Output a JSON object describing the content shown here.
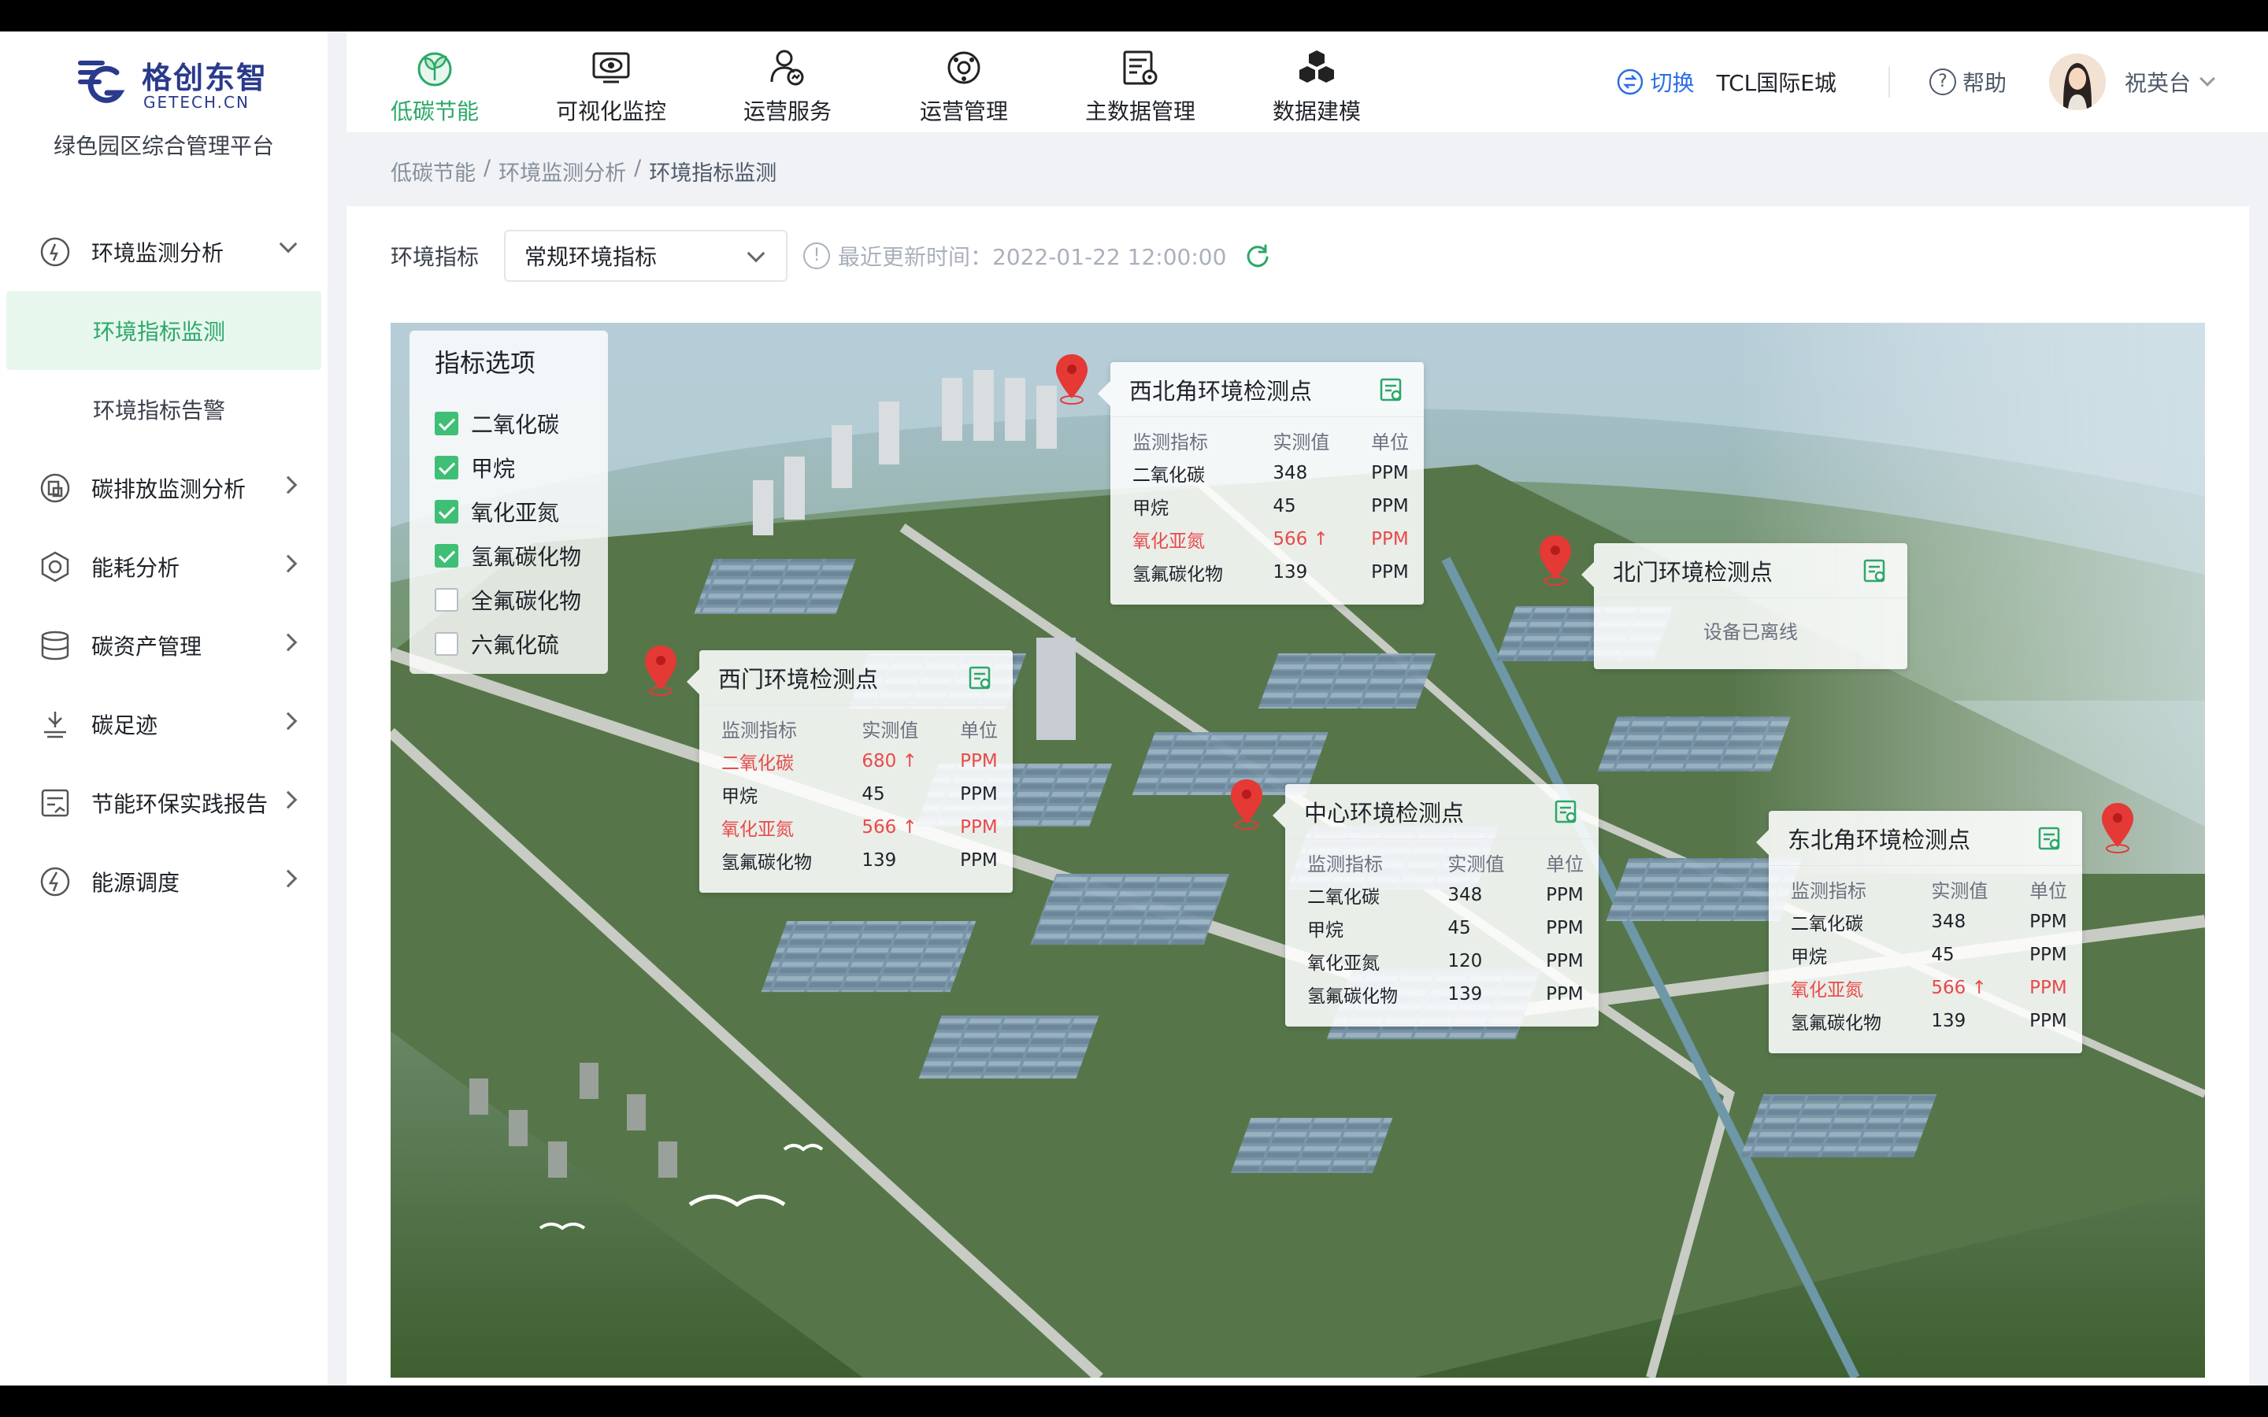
{
  "brand": {
    "logo_cn": "格创东智",
    "logo_en": "GETECH.CN",
    "platform": "绿色园区综合管理平台"
  },
  "sidebar": {
    "items": [
      {
        "label": "环境监测分析",
        "icon": "environment-icon",
        "expanded": true,
        "children": [
          {
            "label": "环境指标监测",
            "active": true
          },
          {
            "label": "环境指标告警",
            "active": false
          }
        ]
      },
      {
        "label": "碳排放监测分析",
        "icon": "carbon-emission-icon"
      },
      {
        "label": "能耗分析",
        "icon": "energy-icon"
      },
      {
        "label": "碳资产管理",
        "icon": "carbon-asset-icon"
      },
      {
        "label": "碳足迹",
        "icon": "footprint-icon"
      },
      {
        "label": "节能环保实践报告",
        "icon": "report-icon"
      },
      {
        "label": "能源调度",
        "icon": "dispatch-icon"
      }
    ]
  },
  "nav": {
    "tabs": [
      {
        "label": "低碳节能",
        "icon": "leaf-icon",
        "active": true
      },
      {
        "label": "可视化监控",
        "icon": "eye-monitor-icon",
        "active": false
      },
      {
        "label": "运营服务",
        "icon": "service-user-icon",
        "active": false
      },
      {
        "label": "运营管理",
        "icon": "operation-icon",
        "active": false
      },
      {
        "label": "主数据管理",
        "icon": "master-data-icon",
        "active": false
      },
      {
        "label": "数据建模",
        "icon": "cubes-icon",
        "active": false
      }
    ]
  },
  "header": {
    "switch_label": "切换",
    "site_name": "TCL国际E城",
    "help_label": "帮助",
    "user_name": "祝英台"
  },
  "breadcrumb": [
    "低碳节能",
    "环境监测分析",
    "环境指标监测"
  ],
  "filter": {
    "label": "环境指标",
    "select_value": "常规环境指标",
    "update_time": "最近更新时间：2022-01-22 12:00:00"
  },
  "indicator_panel": {
    "title": "指标选项",
    "options": [
      {
        "label": "二氧化碳",
        "checked": true
      },
      {
        "label": "甲烷",
        "checked": true
      },
      {
        "label": "氧化亚氮",
        "checked": true
      },
      {
        "label": "氢氟碳化物",
        "checked": true
      },
      {
        "label": "全氟碳化物",
        "checked": false
      },
      {
        "label": "六氟化硫",
        "checked": false
      }
    ]
  },
  "table_headers": [
    "监测指标",
    "实测值",
    "单位"
  ],
  "stations": [
    {
      "id": "northwest",
      "name": "西北角环境检测点",
      "status": "online",
      "rows": [
        {
          "name": "二氧化碳",
          "value": "348",
          "unit": "PPM",
          "alarm": false
        },
        {
          "name": "甲烷",
          "value": "45",
          "unit": "PPM",
          "alarm": false
        },
        {
          "name": "氧化亚氮",
          "value": "566 ↑",
          "unit": "PPM",
          "alarm": true
        },
        {
          "name": "氢氟碳化物",
          "value": "139",
          "unit": "PPM",
          "alarm": false
        }
      ]
    },
    {
      "id": "north",
      "name": "北门环境检测点",
      "status": "offline",
      "offline_text": "设备已离线",
      "rows": []
    },
    {
      "id": "west",
      "name": "西门环境检测点",
      "status": "online",
      "rows": [
        {
          "name": "二氧化碳",
          "value": "680 ↑",
          "unit": "PPM",
          "alarm": true
        },
        {
          "name": "甲烷",
          "value": "45",
          "unit": "PPM",
          "alarm": false
        },
        {
          "name": "氧化亚氮",
          "value": "566 ↑",
          "unit": "PPM",
          "alarm": true
        },
        {
          "name": "氢氟碳化物",
          "value": "139",
          "unit": "PPM",
          "alarm": false
        }
      ]
    },
    {
      "id": "center",
      "name": "中心环境检测点",
      "status": "online",
      "rows": [
        {
          "name": "二氧化碳",
          "value": "348",
          "unit": "PPM",
          "alarm": false
        },
        {
          "name": "甲烷",
          "value": "45",
          "unit": "PPM",
          "alarm": false
        },
        {
          "name": "氧化亚氮",
          "value": "120",
          "unit": "PPM",
          "alarm": false
        },
        {
          "name": "氢氟碳化物",
          "value": "139",
          "unit": "PPM",
          "alarm": false
        }
      ]
    },
    {
      "id": "northeast",
      "name": "东北角环境检测点",
      "status": "online",
      "rows": [
        {
          "name": "二氧化碳",
          "value": "348",
          "unit": "PPM",
          "alarm": false
        },
        {
          "name": "甲烷",
          "value": "45",
          "unit": "PPM",
          "alarm": false
        },
        {
          "name": "氧化亚氮",
          "value": "566 ↑",
          "unit": "PPM",
          "alarm": true
        },
        {
          "name": "氢氟碳化物",
          "value": "139",
          "unit": "PPM",
          "alarm": false
        }
      ]
    }
  ],
  "colors": {
    "accent": "#2aa868",
    "alarm": "#e84a4a",
    "link": "#2b6de5",
    "pin": "#e53935"
  }
}
